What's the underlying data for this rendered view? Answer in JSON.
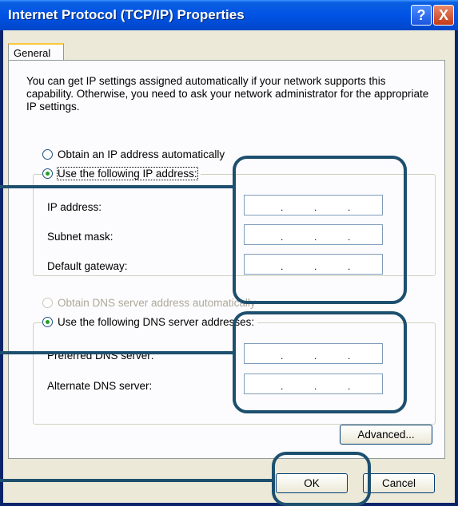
{
  "window": {
    "title": "Internet Protocol (TCP/IP) Properties",
    "help_glyph": "?",
    "close_glyph": "X"
  },
  "tabs": [
    {
      "label": "General"
    }
  ],
  "description": "You can get IP settings assigned automatically if your network supports this capability. Otherwise, you need to ask your network administrator for the appropriate IP settings.",
  "ip_section": {
    "auto_radio": {
      "label": "Obtain an IP address automatically",
      "selected": false
    },
    "manual_radio": {
      "label": "Use the following IP address:",
      "selected": true
    },
    "fields": [
      {
        "label": "IP address:",
        "value": ". . ."
      },
      {
        "label": "Subnet mask:",
        "value": ". . ."
      },
      {
        "label": "Default gateway:",
        "value": ". . ."
      }
    ]
  },
  "dns_section": {
    "auto_radio": {
      "label": "Obtain DNS server address automatically",
      "selected": false,
      "disabled": true
    },
    "manual_radio": {
      "label": "Use the following DNS server addresses:",
      "selected": true
    },
    "fields": [
      {
        "label": "Preferred DNS server:",
        "value": ". . ."
      },
      {
        "label": "Alternate DNS server:",
        "value": ". . ."
      }
    ]
  },
  "buttons": {
    "advanced": "Advanced...",
    "ok": "OK",
    "cancel": "Cancel"
  },
  "ip_dot": "."
}
